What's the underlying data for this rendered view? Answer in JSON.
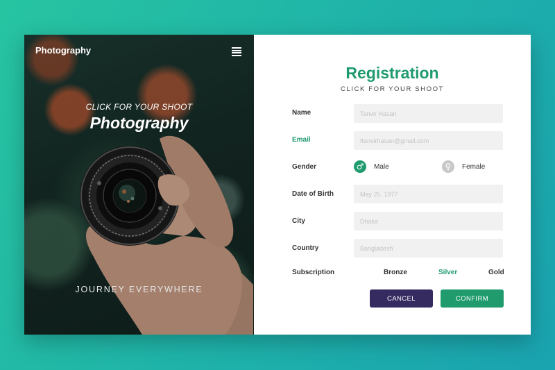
{
  "left_panel": {
    "brand": "Photography",
    "hero_subtitle": "CLICK FOR YOUR SHOOT",
    "hero_title": "Photography",
    "footer_text": "JOURNEY EVERYWHERE",
    "menu_icon": "hamburger-menu-icon"
  },
  "form": {
    "title": "Registration",
    "subtitle": "CLICK FOR YOUR SHOOT",
    "name": {
      "label": "Name",
      "placeholder": "Tanvir Hasan"
    },
    "email": {
      "label": "Email",
      "placeholder": "ftanvirhasan@gmail.com"
    },
    "gender": {
      "label": "Gender",
      "options": [
        {
          "label": "Male",
          "icon": "male-icon",
          "selected": true
        },
        {
          "label": "Female",
          "icon": "female-icon",
          "selected": false
        }
      ]
    },
    "dob": {
      "label": "Date of Birth",
      "placeholder": "May 25, 1977"
    },
    "city": {
      "label": "City",
      "placeholder": "Dhaka"
    },
    "country": {
      "label": "Country",
      "placeholder": "Bangladesh"
    },
    "subscription": {
      "label": "Subscription",
      "options": [
        "Bronze",
        "Silver",
        "Gold"
      ],
      "selected": "Silver"
    },
    "buttons": {
      "cancel": "CANCEL",
      "confirm": "CONFIRM"
    }
  },
  "colors": {
    "accent": "#1f9b6e",
    "cancel_button": "#352b60",
    "background_start": "#27c4a1",
    "background_end": "#1aa3b0"
  }
}
